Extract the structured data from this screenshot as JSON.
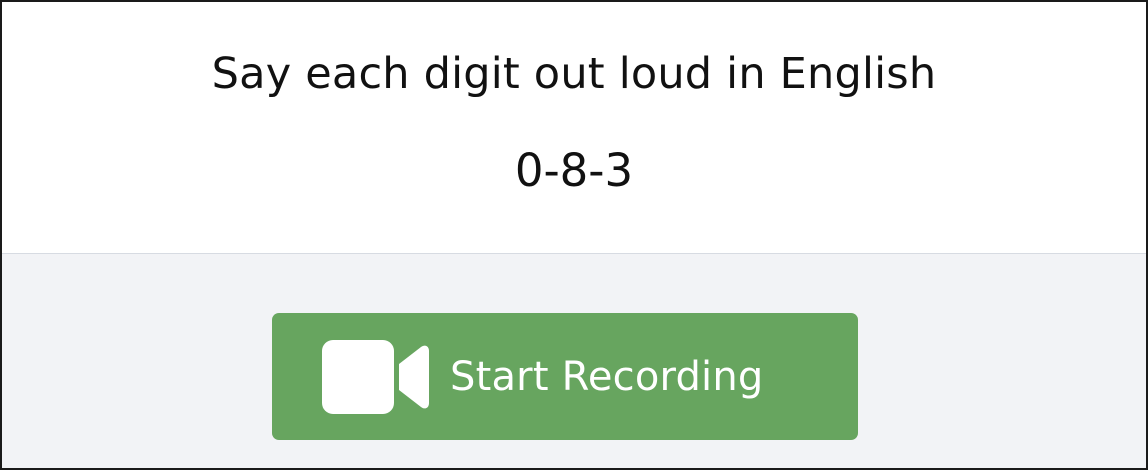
{
  "prompt": {
    "instruction": "Say each digit out loud in English",
    "digits": "0-8-3"
  },
  "actions": {
    "start_recording_label": "Start Recording",
    "start_recording_icon": "video-camera-icon"
  },
  "colors": {
    "button_background": "#67a55f",
    "button_text": "#ffffff",
    "lower_panel_background": "#f2f3f6",
    "border": "#1a1a1a"
  }
}
